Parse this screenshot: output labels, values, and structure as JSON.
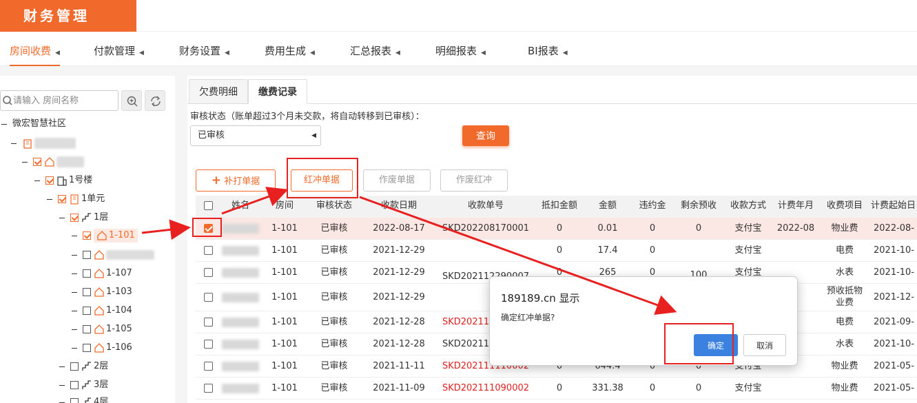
{
  "brand": "财务管理",
  "nav": [
    {
      "label": "房间收费",
      "active": true
    },
    {
      "label": "付款管理"
    },
    {
      "label": "财务设置"
    },
    {
      "label": "费用生成"
    },
    {
      "label": "汇总报表"
    },
    {
      "label": "明细报表"
    },
    {
      "label": "BI报表"
    }
  ],
  "sidebar": {
    "search_placeholder": "请输入 房间名称",
    "tree": {
      "community": "微宏智慧社区",
      "building": "1号楼",
      "unit": "1单元",
      "floor1": "1层",
      "rooms": [
        "1-101",
        "1-107",
        "1-103",
        "1-104",
        "1-105",
        "1-106"
      ],
      "floor2": "2层",
      "floor3": "3层",
      "floor4": "4层"
    }
  },
  "tabs": [
    {
      "label": "欠费明细"
    },
    {
      "label": "缴费记录",
      "active": true
    }
  ],
  "filter": {
    "label": "审核状态（账单超过3个月未交款，将自动转移到已审核）：",
    "selected": "已审核",
    "query_label": "查询"
  },
  "toolbar": {
    "reprint": "补打单据",
    "redflush": "红冲单据",
    "void": "作废单据",
    "void_red": "作废红冲"
  },
  "table": {
    "headers": [
      "姓名",
      "房间",
      "审核状态",
      "收款日期",
      "收款单号",
      "抵扣金额",
      "金额",
      "违约金",
      "剩余预收",
      "收款方式",
      "计费年月",
      "收费项目",
      "计费起始日"
    ],
    "rows": [
      {
        "room": "1-101",
        "status": "已审核",
        "date": "2022-08-17",
        "no": "SKD202208170001",
        "deduct": "0",
        "amount": "0.01",
        "penalty": "0",
        "remain": "0",
        "method": "支付宝",
        "month": "2022-08",
        "item": "物业费",
        "start": "2022-08-"
      },
      {
        "room": "1-101",
        "status": "已审核",
        "date": "2021-12-29",
        "no": "",
        "deduct": "0",
        "amount": "17.4",
        "penalty": "0",
        "remain": "",
        "method": "支付宝",
        "month": "",
        "item": "电费",
        "start": "2021-10-"
      },
      {
        "room": "1-101",
        "status": "已审核",
        "date": "2021-12-29",
        "no": "SKD202112290007",
        "deduct": "0",
        "amount": "265",
        "penalty": "0",
        "remain": "100",
        "method": "支付宝",
        "month": "",
        "item": "水表",
        "start": "2021-10-"
      },
      {
        "room": "1-101",
        "status": "已审核",
        "date": "2021-12-29",
        "no": "",
        "deduct": "",
        "amount": "",
        "penalty": "",
        "remain": "",
        "method": "",
        "month": "",
        "item": "预收抵物业费",
        "start": "2021-12-"
      },
      {
        "room": "1-101",
        "status": "已审核",
        "date": "2021-12-28",
        "no": "SKD20211",
        "deduct": "",
        "amount": "",
        "penalty": "",
        "remain": "",
        "method": "",
        "month": "",
        "item": "电费",
        "start": "2021-09-"
      },
      {
        "room": "1-101",
        "status": "已审核",
        "date": "2021-12-28",
        "no": "SKD20211",
        "deduct": "",
        "amount": "",
        "penalty": "",
        "remain": "",
        "method": "",
        "month": "",
        "item": "水表",
        "start": "2021-10-"
      },
      {
        "room": "1-101",
        "status": "已审核",
        "date": "2021-11-11",
        "no": "SKD202111110002",
        "deduct": "0",
        "amount": "644.4",
        "penalty": "0",
        "remain": "0",
        "method": "支付宝",
        "month": "",
        "item": "物业费",
        "start": "2021-05-"
      },
      {
        "room": "1-101",
        "status": "已审核",
        "date": "2021-11-09",
        "no": "SKD202111090002",
        "deduct": "0",
        "amount": "331.38",
        "penalty": "0",
        "remain": "0",
        "method": "支付宝",
        "month": "",
        "item": "物业费",
        "start": "2021-05-"
      }
    ]
  },
  "dialog": {
    "title": "189189.cn 显示",
    "message": "确定红冲单据?",
    "ok": "确定",
    "cancel": "取消"
  },
  "colors": {
    "brand": "#f26a2b",
    "annotation": "#e8201f",
    "dialog_ok": "#3b82e0"
  }
}
